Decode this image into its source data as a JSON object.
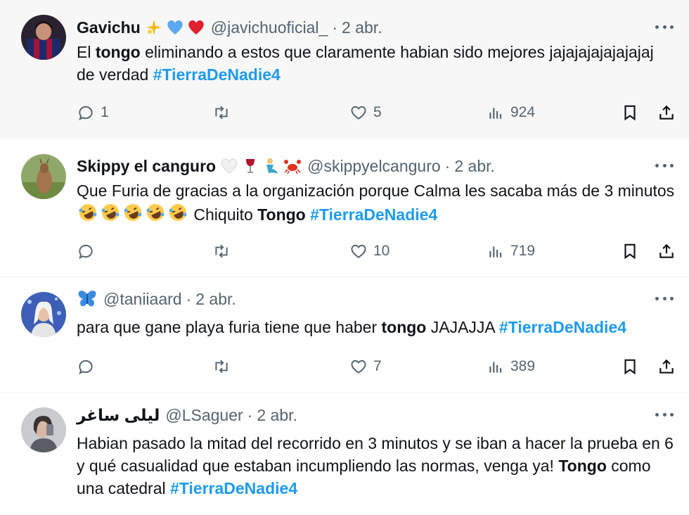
{
  "tweets": [
    {
      "name": "Gavichu",
      "handle": "@javichuoficial_",
      "time": "2 abr.",
      "text_parts": [
        "El ",
        "tongo",
        " eliminando a estos que claramente habian sido mejores jajajajajajajajaj de verdad ",
        "#TierraDeNadie4"
      ],
      "replies": "1",
      "likes": "5",
      "views": "924"
    },
    {
      "name": "Skippy el canguro",
      "handle": "@skippyelcanguro",
      "time": "2 abr.",
      "text_parts": [
        "Que Furia de gracias a la organización porque Calma les sacaba más de 3 minutos ",
        " Chiquito ",
        "Tongo",
        " ",
        "#TierraDeNadie4"
      ],
      "replies": "",
      "likes": "10",
      "views": "719"
    },
    {
      "name": "",
      "handle": "@taniiaard",
      "time": "2 abr.",
      "text_parts": [
        "para que gane playa furia tiene que haber ",
        "tongo",
        " JAJAJJA ",
        "#TierraDeNadie4"
      ],
      "replies": "",
      "likes": "7",
      "views": "389"
    },
    {
      "name": "ليلى ساغر",
      "handle": "@LSaguer",
      "time": "2 abr.",
      "text_parts": [
        "Habian pasado la mitad del recorrido en 3 minutos y se iban a hacer la prueba en 6 y qué casualidad que estaban incumpliendo las normas, venga ya! ",
        "Tongo",
        " como una catedral ",
        "#TierraDeNadie4"
      ]
    }
  ],
  "sep": "·",
  "icons": [
    "reply-icon",
    "retweet-icon",
    "like-icon",
    "views-icon",
    "bookmark-icon",
    "share-icon",
    "more-icon"
  ],
  "colors": {
    "accent": "#1d9bf0",
    "muted": "#536471",
    "text": "#0f1419",
    "heart": "#f91880",
    "blue_heart": "#5aa9f0"
  }
}
